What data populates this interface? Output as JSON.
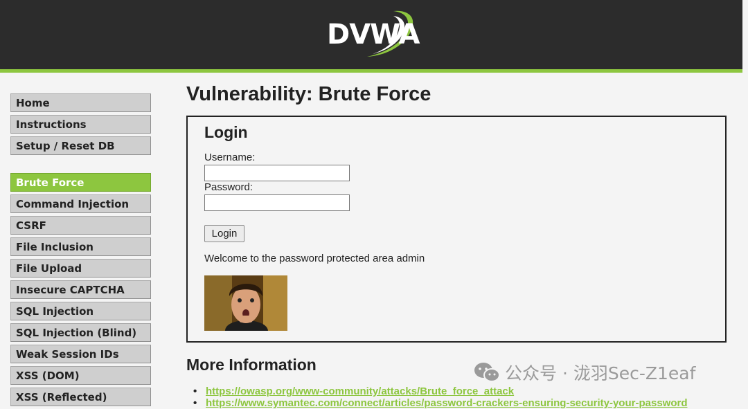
{
  "header": {
    "logo_text": "DVWA"
  },
  "sidebar": {
    "top_items": [
      {
        "label": "Home"
      },
      {
        "label": "Instructions"
      },
      {
        "label": "Setup / Reset DB"
      }
    ],
    "vuln_items": [
      {
        "label": "Brute Force",
        "active": true
      },
      {
        "label": "Command Injection"
      },
      {
        "label": "CSRF"
      },
      {
        "label": "File Inclusion"
      },
      {
        "label": "File Upload"
      },
      {
        "label": "Insecure CAPTCHA"
      },
      {
        "label": "SQL Injection"
      },
      {
        "label": "SQL Injection (Blind)"
      },
      {
        "label": "Weak Session IDs"
      },
      {
        "label": "XSS (DOM)"
      },
      {
        "label": "XSS (Reflected)"
      }
    ]
  },
  "main": {
    "title": "Vulnerability: Brute Force",
    "login": {
      "heading": "Login",
      "username_label": "Username:",
      "username_value": "",
      "password_label": "Password:",
      "password_value": "",
      "button_label": "Login",
      "welcome": "Welcome to the password protected area admin"
    },
    "more_info": {
      "heading": "More Information",
      "links": [
        "https://owasp.org/www-community/attacks/Brute_force_attack",
        "https://www.symantec.com/connect/articles/password-crackers-ensuring-security-your-password"
      ]
    }
  },
  "watermark": {
    "text": "公众号 · 泷羽Sec-Z1eaf"
  },
  "colors": {
    "accent": "#8dc63f",
    "header_bg": "#2c2c2c"
  }
}
